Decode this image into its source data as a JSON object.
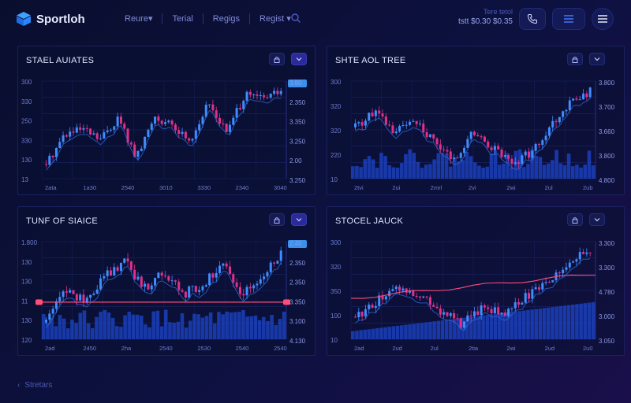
{
  "app": {
    "logo_text": "Sportloh",
    "nav": [
      "Reure▾",
      "Terial",
      "Regigs",
      "Regist ▾"
    ],
    "ticker_top": "Tere  tetol",
    "ticker_bottom": "tstt  $0.30  $0.35",
    "back_label": "Stretars"
  },
  "colors": {
    "accent": "#3fa0ff",
    "bull": "#3f8cff",
    "bear": "#e0308a",
    "line": "#ff4d7a"
  },
  "panels": [
    {
      "title": "STAEL AUIATES",
      "y_left": [
        "300",
        "330",
        "250",
        "330",
        "130",
        "13"
      ],
      "y_right": [
        "3.80",
        "2.350",
        "3.350",
        "3.250",
        "2.00",
        "3.250"
      ],
      "x": [
        "2ata",
        "1a30",
        "2540",
        "3010",
        "3330",
        "2340",
        "3040"
      ]
    },
    {
      "title": "SHTE AOL TREE",
      "y_left": [
        "300",
        "320",
        "320",
        "220",
        "10"
      ],
      "y_right": [
        "3.800",
        "3.700",
        "3.660",
        "3.800",
        "4.800"
      ],
      "x": [
        "2tvi",
        "2ui",
        "2mrl",
        "2vi",
        "2wi",
        "2ul",
        "2ub"
      ]
    },
    {
      "title": "TUNF OF SIAICE",
      "y_left": [
        "1.800",
        "130",
        "130",
        "11",
        "130",
        "120"
      ],
      "y_right": [
        "2.40",
        "2.350",
        "2.350",
        "3.350",
        "3.100",
        "4.130"
      ],
      "x": [
        "2ad",
        "2450",
        "2ha",
        "2540",
        "2530",
        "2540",
        "2540"
      ]
    },
    {
      "title": "STOCEL JAUCK",
      "y_left": [
        "300",
        "320",
        "350",
        "100",
        "10"
      ],
      "y_right": [
        "3.300",
        "3.300",
        "4.780",
        "3.000",
        "3.050"
      ],
      "x": [
        "2ad",
        "2ud",
        "2ul",
        "2tia",
        "2wi",
        "2ud",
        "2u0"
      ]
    }
  ],
  "chart_data": [
    {
      "type": "line",
      "title": "STAEL AUIATES",
      "x": [
        "2ata",
        "1a30",
        "2540",
        "3010",
        "3330",
        "2340",
        "3040"
      ],
      "series": [
        {
          "values": [
            100,
            160,
            170,
            150,
            195,
            110,
            200,
            175,
            150,
            225,
            165,
            240,
            235,
            250
          ]
        }
      ]
    },
    {
      "type": "line",
      "title": "SHTE AOL TREE",
      "x": [
        "2tvi",
        "2ui",
        "2mrl",
        "2vi",
        "2wi",
        "2ul",
        "2ub"
      ],
      "series": [
        {
          "values": [
            200,
            230,
            190,
            220,
            170,
            135,
            190,
            160,
            130,
            150,
            205,
            250,
            270
          ]
        }
      ]
    },
    {
      "type": "line",
      "title": "TUNF OF SIAICE",
      "x": [
        "2ad",
        "2450",
        "2ha",
        "2540",
        "2530",
        "2540",
        "2540"
      ],
      "series": [
        {
          "values": [
            90,
            150,
            130,
            175,
            200,
            150,
            185,
            140,
            160,
            195,
            145,
            170,
            215
          ]
        }
      ]
    },
    {
      "type": "line",
      "title": "STOCEL JAUCK",
      "x": [
        "2ad",
        "2ud",
        "2ul",
        "2tia",
        "2wi",
        "2ud",
        "2u0"
      ],
      "series": [
        {
          "values": [
            170,
            200,
            230,
            215,
            180,
            155,
            190,
            175,
            210,
            240,
            280,
            300
          ]
        }
      ]
    }
  ]
}
